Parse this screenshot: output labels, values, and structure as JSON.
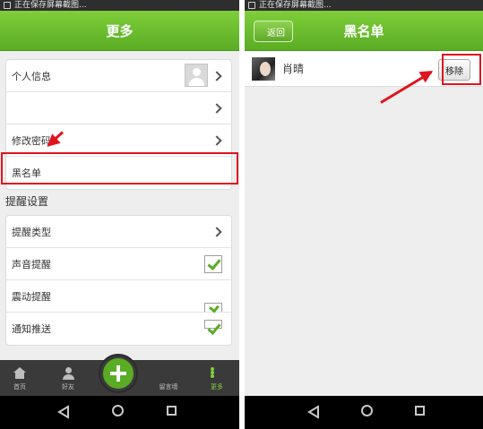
{
  "left_screen": {
    "status_text": "正在保存屏幕截图...",
    "title": "更多",
    "group1": [
      {
        "label": "个人信息",
        "has_avatar": true
      },
      {
        "label": ""
      },
      {
        "label": "修改密码"
      },
      {
        "label": "黑名单"
      }
    ],
    "section_title": "提醒设置",
    "group2": [
      {
        "label": "提醒类型"
      },
      {
        "label": "声音提醒",
        "checked": true
      },
      {
        "label": "震动提醒",
        "checked": true
      },
      {
        "label": "通知推送",
        "checked": true
      }
    ],
    "tabs": [
      {
        "label": "首页",
        "icon": "home-icon"
      },
      {
        "label": "好友",
        "icon": "friends-icon"
      },
      {
        "label": "留言墙",
        "icon": "grid-icon"
      },
      {
        "label": "更多",
        "icon": "more-dots-icon",
        "active": true
      }
    ],
    "fab_icon": "plus-icon"
  },
  "right_screen": {
    "status_text": "正在保存屏幕截图...",
    "back_label": "返回",
    "title": "黑名单",
    "entry_name": "肖晴",
    "remove_label": "移除"
  },
  "colors": {
    "brand_green": "#5aac24",
    "highlight_red": "#e0141e",
    "tabbar_dark": "#3a3a3a"
  }
}
